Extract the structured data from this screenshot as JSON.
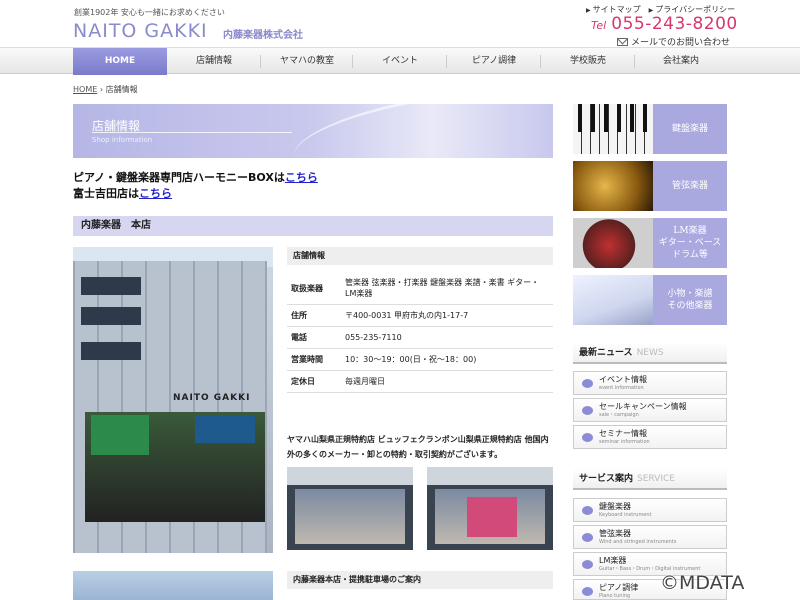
{
  "header": {
    "tagline": "創業1902年 安心も一緒にお求めください",
    "logo": "NAITO GAKKI",
    "company": "内藤楽器株式会社",
    "toplinks": [
      "サイトマップ",
      "プライバシーポリシー"
    ],
    "tel_label": "Tel",
    "tel_number": "055-243-8200",
    "mail_link": "メールでのお問い合わせ"
  },
  "nav": [
    "HOME",
    "店舗情報",
    "ヤマハの教室",
    "イベント",
    "ピアノ調律",
    "学校販売",
    "会社案内"
  ],
  "breadcrumb": {
    "home": "HOME",
    "current": "店舗情報"
  },
  "banner": {
    "title": "店舗情報",
    "subtitle": "Shop information"
  },
  "intro": {
    "line1_text": "ピアノ・鍵盤楽器専門店ハーモニーBOXは",
    "line1_link": "こちら",
    "line2_text": "富士吉田店は",
    "line2_link": "こちら"
  },
  "section_title": "内藤楽器　本店",
  "store_photo": {
    "logo_text": "NAITO GAKKI"
  },
  "info": {
    "heading": "店舗情報",
    "rows": [
      {
        "key": "取扱楽器",
        "value": "管楽器 弦楽器・打楽器 鍵盤楽器 楽譜・楽書 ギター・LM楽器"
      },
      {
        "key": "住所",
        "value": "〒400-0031 甲府市丸の内1-17-7"
      },
      {
        "key": "電話",
        "value": "055-235-7110"
      },
      {
        "key": "営業時間",
        "value": "10：30～19：00(日・祝～18：00)"
      },
      {
        "key": "定休日",
        "value": "毎週月曜日"
      }
    ]
  },
  "description": "ヤマハ山梨県正規特約店 ビュッフェクランポン山梨県正規特約店 他国内外の多くのメーカー・卸との特約・取引契約がございます。",
  "map_heading": "内藤楽器本店・提携駐車場のご案内",
  "sidebar": {
    "categories": [
      {
        "label": "鍵盤楽器",
        "icon": "piano-keys"
      },
      {
        "label": "管弦楽器",
        "icon": "saxophone"
      },
      {
        "label": "LM楽器\nギター・ベース\nドラム等",
        "icon": "guitar"
      },
      {
        "label": "小物・楽譜\nその他楽器",
        "icon": "flute"
      }
    ],
    "news_title": "最新ニュース",
    "news_title_en": "NEWS",
    "news": [
      {
        "jp": "イベント情報",
        "en": "event information"
      },
      {
        "jp": "セールキャンペーン情報",
        "en": "sale・campaign"
      },
      {
        "jp": "セミナー情報",
        "en": "seminar information"
      }
    ],
    "service_title": "サービス案内",
    "service_title_en": "SERVICE",
    "services": [
      {
        "jp": "鍵盤楽器",
        "en": "Keyboard instrument"
      },
      {
        "jp": "管弦楽器",
        "en": "Wind and stringed instruments"
      },
      {
        "jp": "LM楽器",
        "en": "Guitar・Bass・Drum・Digital instrument"
      },
      {
        "jp": "ピアノ調律",
        "en": "Piano tuning"
      }
    ]
  },
  "watermark": "©MDATA",
  "colors": {
    "accent": "#8a8acc",
    "phone": "#d9366c",
    "nav_active": "#7a7acc"
  }
}
